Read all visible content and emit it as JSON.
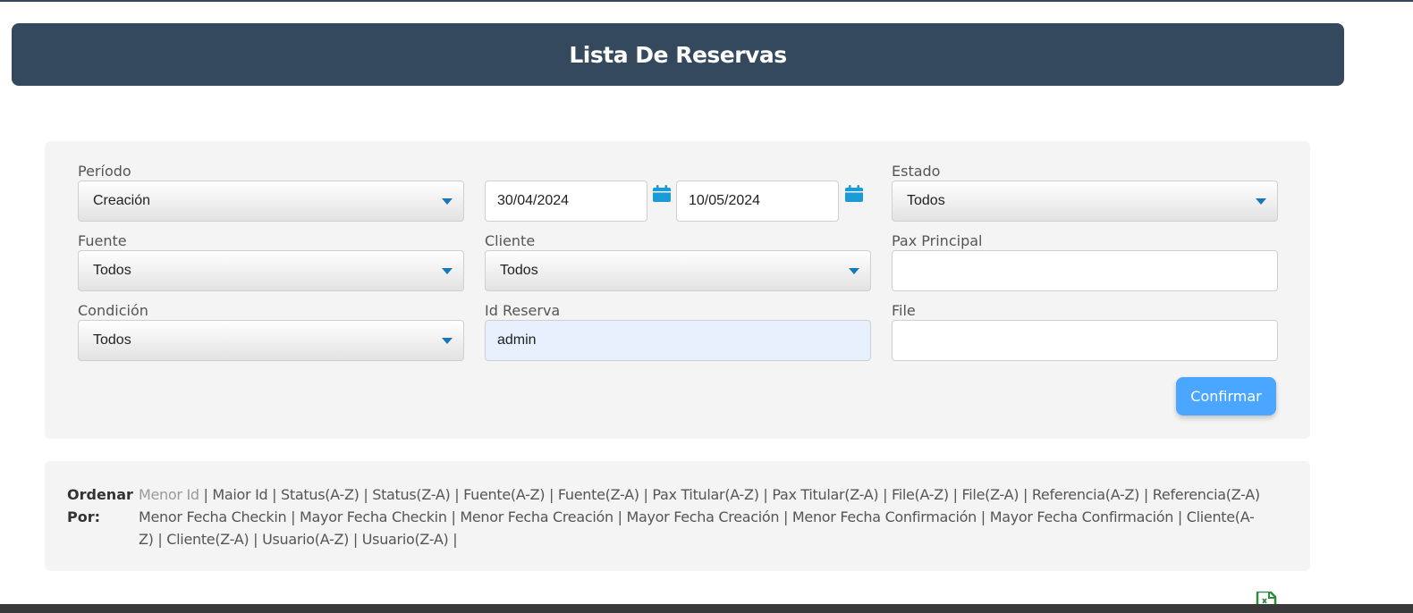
{
  "header": {
    "title": "Lista De Reservas"
  },
  "filters": {
    "periodo": {
      "label": "Período",
      "value": "Creación"
    },
    "date_from": {
      "value": "30/04/2024"
    },
    "date_to": {
      "value": "10/05/2024"
    },
    "estado": {
      "label": "Estado",
      "value": "Todos"
    },
    "fuente": {
      "label": "Fuente",
      "value": "Todos"
    },
    "cliente": {
      "label": "Cliente",
      "value": "Todos"
    },
    "pax_principal": {
      "label": "Pax Principal",
      "value": ""
    },
    "condicion": {
      "label": "Condición",
      "value": "Todos"
    },
    "id_reserva": {
      "label": "Id Reserva",
      "value": "admin"
    },
    "file": {
      "label": "File",
      "value": ""
    },
    "confirm_label": "Confirmar"
  },
  "order": {
    "label": "Ordenar Por:",
    "options": [
      "Menor Id",
      "Maior Id",
      "Status(A-Z)",
      "Status(Z-A)",
      "Fuente(A-Z)",
      "Fuente(Z-A)",
      "Pax Titular(A-Z)",
      "Pax Titular(Z-A)",
      "File(A-Z)",
      "File(Z-A)",
      "Referencia(A-Z)",
      "Referencia(Z-A)",
      "Menor Fecha Checkin",
      "Mayor Fecha Checkin",
      "Menor Fecha Creación",
      "Mayor Fecha Creación",
      "Menor Fecha Confirmación",
      "Mayor Fecha Confirmación",
      "Cliente(A-Z)",
      "Cliente(Z-A)",
      "Usuario(A-Z)",
      "Usuario(Z-A)"
    ],
    "active": "Menor Id"
  },
  "colors": {
    "header_bg": "#34495e",
    "accent": "#4aa6ff",
    "panel_bg": "#f4f4f4",
    "caret": "#1877b8"
  },
  "icons": [
    "calendar-icon",
    "excel-export-icon"
  ]
}
